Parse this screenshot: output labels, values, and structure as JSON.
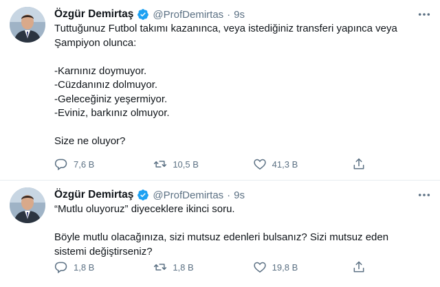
{
  "tweets": [
    {
      "author_name": "Özgür Demirtaş",
      "handle": "@ProfDemirtas",
      "separator": "·",
      "time": "9s",
      "lines": [
        "Tuttuğunuz Futbol takımı kazanınca, veya istediğiniz transferi yapınca veya",
        "Şampiyon olunca:",
        "",
        "-Karnınız doymuyor.",
        "-Cüzdanınız dolmuyor.",
        "-Geleceğiniz yeşermiyor.",
        "-Eviniz, barkınız olmuyor.",
        "",
        "Size ne oluyor?"
      ],
      "replies": "7,6 B",
      "retweets": "10,5 B",
      "likes": "41,3 B"
    },
    {
      "author_name": "Özgür Demirtaş",
      "handle": "@ProfDemirtas",
      "separator": "·",
      "time": "9s",
      "lines": [
        "“Mutlu oluyoruz” diyeceklere ikinci soru.",
        "",
        "Böyle mutlu olacağınıza, sizi mutsuz edenleri bulsanız? Sizi mutsuz eden",
        "sistemi değiştirseniz?"
      ],
      "replies": "1,8 B",
      "retweets": "1,8 B",
      "likes": "19,8 B"
    }
  ],
  "icons": {
    "reply": "reply-icon",
    "retweet": "retweet-icon",
    "like": "like-icon",
    "share": "share-icon",
    "more": "more-icon",
    "verified": "verified-badge-icon"
  },
  "colors": {
    "verified_blue": "#1da1f2",
    "text": "#0f1419",
    "secondary": "#5b7083",
    "divider": "#e6ecf0"
  }
}
